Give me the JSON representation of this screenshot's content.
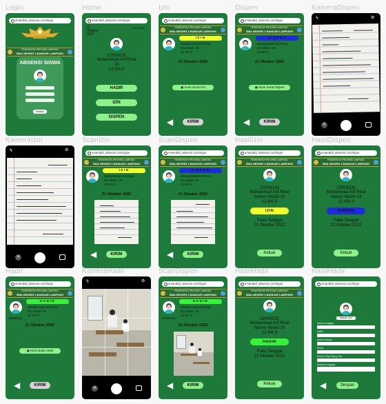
{
  "labels": {
    "f1": "Login",
    "f2": "Home",
    "f3": "Izin",
    "f4": "Dispen",
    "f5": "KameraDispen",
    "f6": "KameraIzin",
    "f7": "ScanIzin",
    "f8": "ScanDispen",
    "f9": "HasilIzin",
    "f10": "HasilDispen",
    "f11": "Hadir",
    "f12": "KameraHadir",
    "f13": "ScanDispen",
    "f14": "HasilHadir",
    "f15": "HasilHadir"
  },
  "url": "smanibdl_absensi.com/login",
  "banner": {
    "top": "PEMERINTAH PROVINSI LAMPUNG",
    "school": "SMA NEGERI 1 BANDAR LAMPUNG"
  },
  "login": {
    "title": "ABSENSI SISWA",
    "button": "Masuk"
  },
  "home": {
    "day": "21",
    "month": "Oktober",
    "year": "2022",
    "edit": "Edit Profile",
    "btn_hadir": "HADIR",
    "btn_izin": "IZIN",
    "btn_dispen": "DISPEN"
  },
  "student": {
    "nis": "12009231",
    "name": "Muhammad Arif Rivai",
    "absen_num": "19",
    "kelas": "12 IPA 3",
    "absen": "No Absen 19",
    "nomor_absen": "Nomor Absen 19"
  },
  "date": "21 Oktober 2022",
  "badges": {
    "izin": "IZIN",
    "dispen": "DISPEN",
    "hadir": "HADIR"
  },
  "buttons": {
    "scan_izin": "Scan Surat Izin",
    "scan_dispen": "Scan Surat Dispen",
    "scan_hadir": "Kirim Bukti Hadir",
    "kirim": "KIRIM",
    "keluar": "Keluar",
    "simpan": "Simpan"
  },
  "result": {
    "pada": "Pada Tanggal"
  },
  "icons": {
    "back": "◀",
    "close": "✕",
    "flash": "ϟ",
    "settings": "⚙"
  },
  "form": {
    "button": "Masuk Info",
    "fields": [
      "Nama Lengkap",
      "NISN",
      "Nomor Absen",
      "Kelas",
      "Nomor Telp Orang Tua",
      "Alamat Lengkap"
    ]
  },
  "colors": {
    "bg_green": "#1e7a3a",
    "btn_green": "#8ef08a",
    "izin_yellow": "#f2ff2c",
    "dispen_blue": "#1d2bd8",
    "hadir_green": "#3bf03b"
  }
}
